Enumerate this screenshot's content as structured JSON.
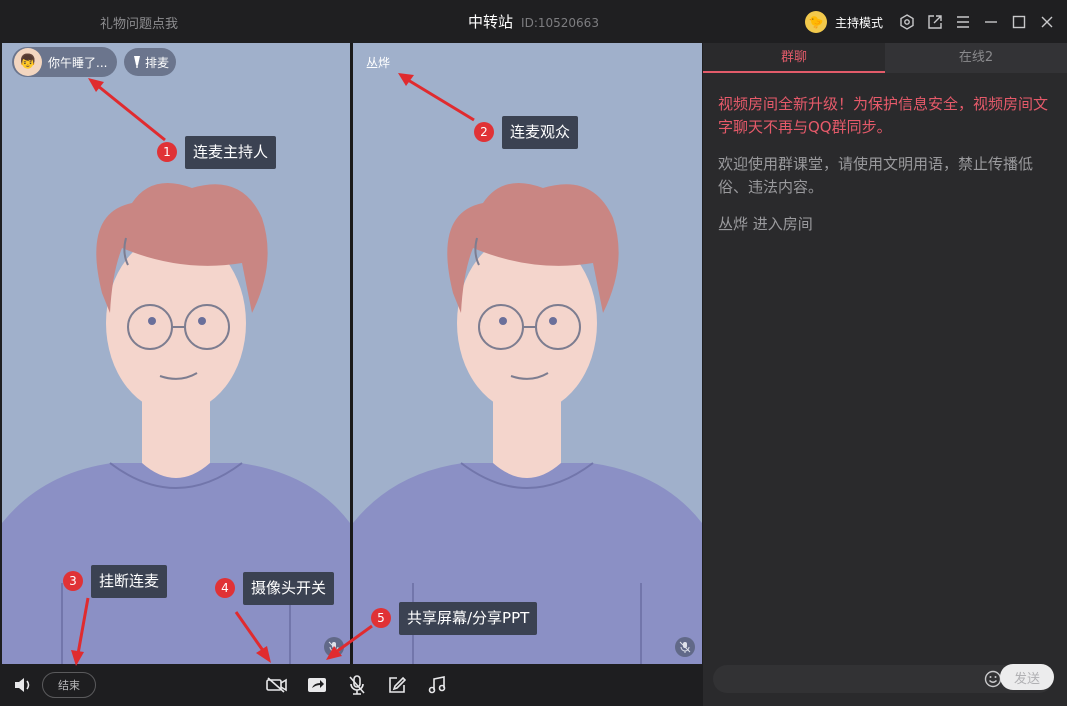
{
  "titlebar": {
    "left_text": "礼物问题点我",
    "title": "中转站",
    "room_id": "ID:10520663",
    "host_mode": "主持模式",
    "icons": [
      "settings-icon",
      "popout-icon",
      "menu-icon",
      "minimize-icon",
      "maximize-icon",
      "close-icon"
    ]
  },
  "video": {
    "host_name": "你午睡了...",
    "queue_label": "排麦",
    "audience_name": "丛烨"
  },
  "toolbar": {
    "end_label": "结束",
    "icons": [
      "speaker-icon",
      "camera-off-icon",
      "share-screen-icon",
      "mic-off-icon",
      "edit-icon",
      "music-icon"
    ]
  },
  "chat": {
    "tabs": [
      {
        "label": "群聊",
        "active": true
      },
      {
        "label": "在线2",
        "active": false
      }
    ],
    "messages": [
      {
        "type": "warning",
        "text": "视频房间全新升级！为保护信息安全，视频房间文字聊天不再与QQ群同步。"
      },
      {
        "type": "info",
        "text": "欢迎使用群课堂，请使用文明用语，禁止传播低俗、违法内容。"
      },
      {
        "type": "system",
        "text": "丛烨 进入房间"
      }
    ],
    "send_label": "发送",
    "accent_color": "#e35b6a"
  },
  "annotations": [
    {
      "num": "1",
      "label": "连麦主持人"
    },
    {
      "num": "2",
      "label": "连麦观众"
    },
    {
      "num": "3",
      "label": "挂断连麦"
    },
    {
      "num": "4",
      "label": "摄像头开关"
    },
    {
      "num": "5",
      "label": "共享屏幕/分享PPT"
    }
  ]
}
